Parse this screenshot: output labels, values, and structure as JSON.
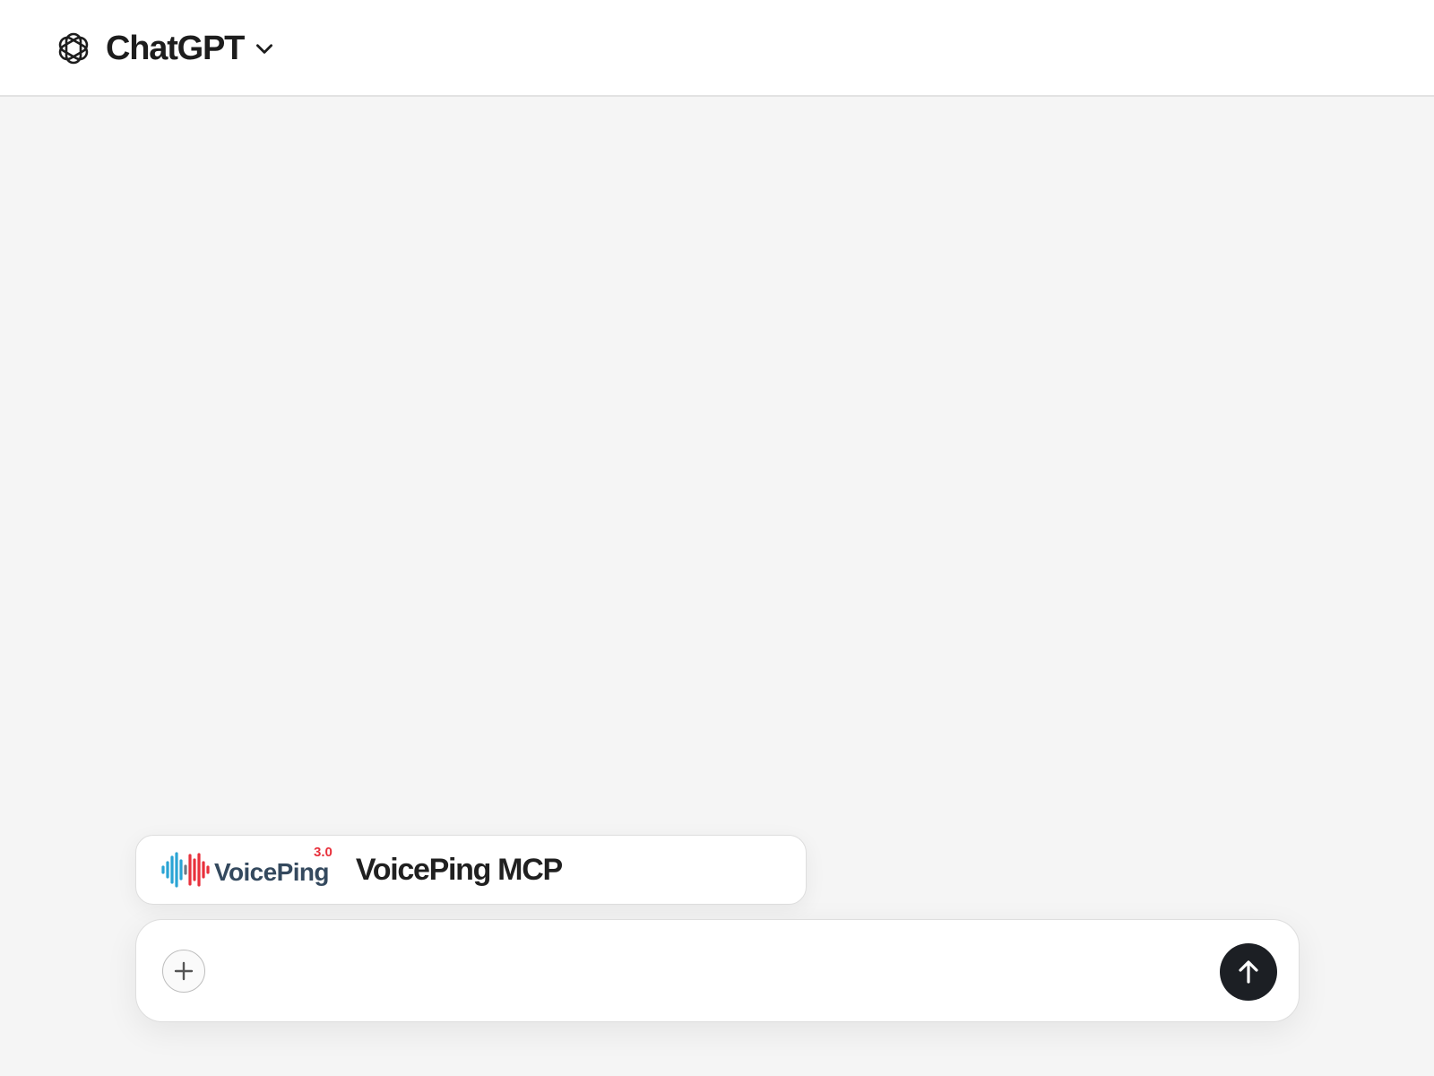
{
  "header": {
    "title": "ChatGPT",
    "logo_icon": "openai-logo-icon",
    "dropdown_icon": "chevron-down-icon"
  },
  "app_card": {
    "logo_text": "VoicePing",
    "logo_version": "3.0",
    "name": "VoicePing MCP",
    "colors": {
      "wave_blue": "#2aa4d4",
      "wave_red": "#e8313c",
      "wordmark": "#34495e"
    }
  },
  "composer": {
    "placeholder": "",
    "value": "",
    "attach_icon": "plus-icon",
    "send_icon": "arrow-up-icon"
  },
  "colors": {
    "background": "#f5f5f5",
    "header_bg": "#ffffff",
    "send_button": "#1c1f24"
  }
}
